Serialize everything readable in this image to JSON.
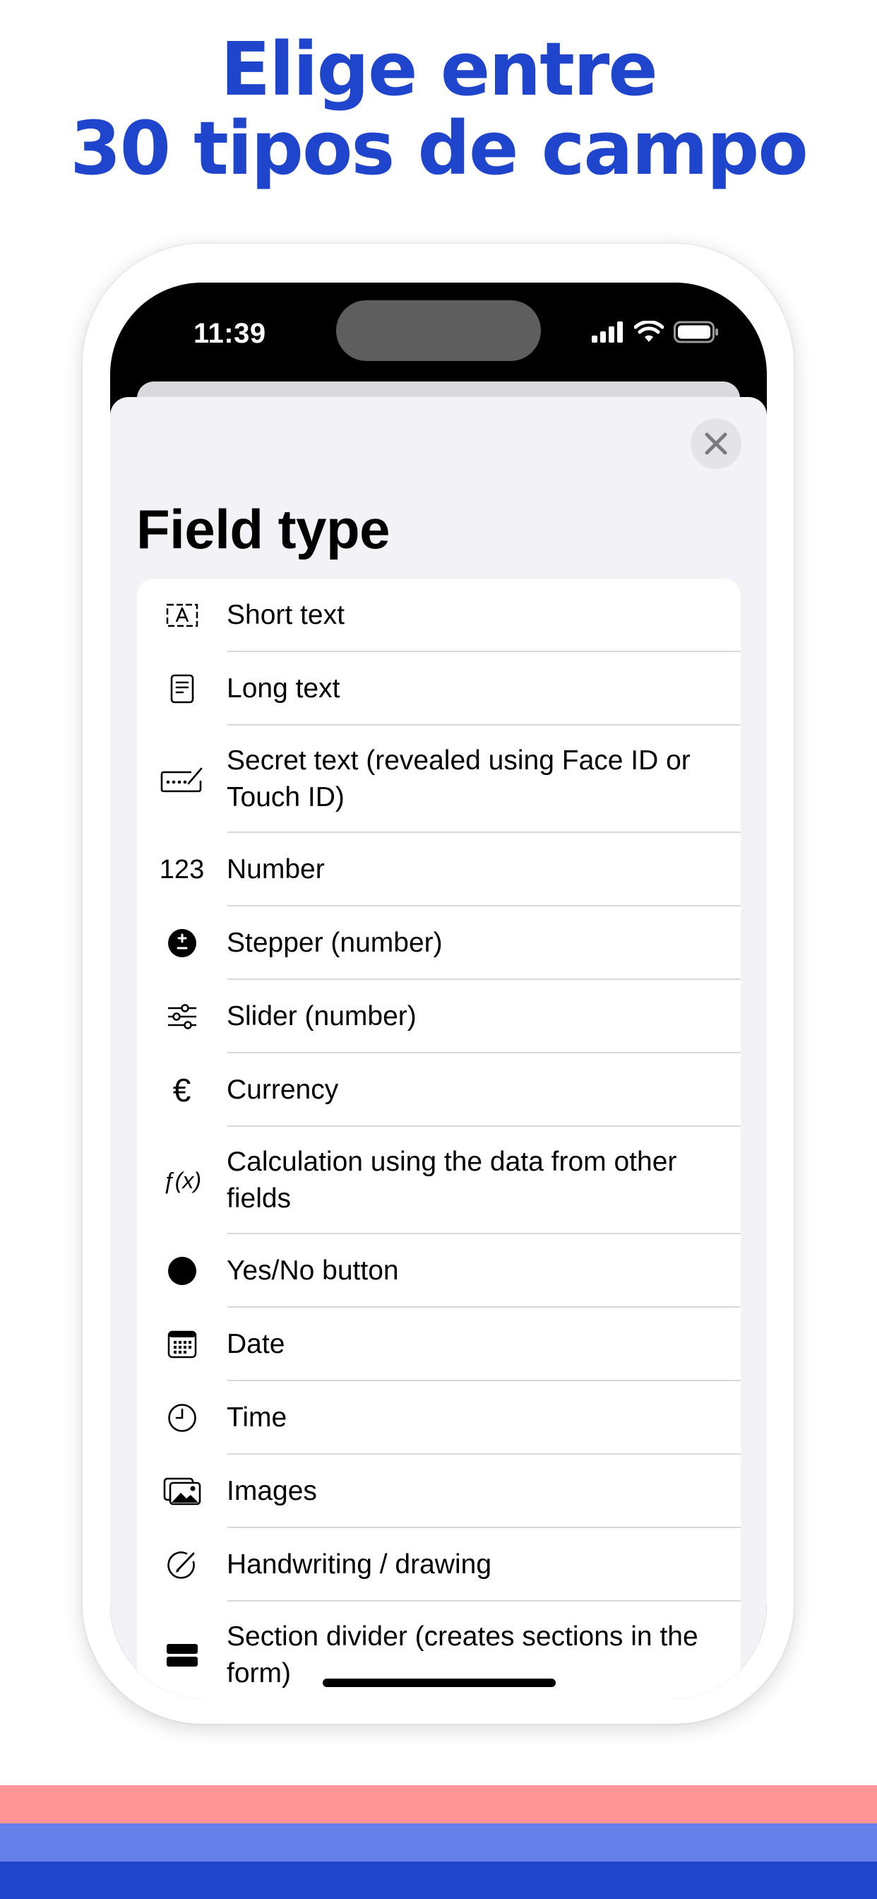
{
  "headline": {
    "line1": "Elige entre",
    "line2": "30 tipos de campo"
  },
  "status_bar": {
    "time": "11:39"
  },
  "sheet": {
    "title": "Field type"
  },
  "field_types": [
    {
      "label": "Short text",
      "icon": "short-text-icon"
    },
    {
      "label": "Long text",
      "icon": "long-text-icon"
    },
    {
      "label": "Secret text (revealed using Face ID or Touch ID)",
      "icon": "secret-text-icon"
    },
    {
      "label": "Number",
      "icon": "number-icon",
      "glyph": "123"
    },
    {
      "label": "Stepper (number)",
      "icon": "stepper-icon"
    },
    {
      "label": "Slider (number)",
      "icon": "slider-icon"
    },
    {
      "label": "Currency",
      "icon": "currency-icon",
      "glyph": "€"
    },
    {
      "label": "Calculation using the data from other fields",
      "icon": "calculation-icon",
      "glyph": "ƒ(x)"
    },
    {
      "label": "Yes/No button",
      "icon": "yes-no-icon"
    },
    {
      "label": "Date",
      "icon": "calendar-icon"
    },
    {
      "label": "Time",
      "icon": "clock-icon"
    },
    {
      "label": "Images",
      "icon": "images-icon"
    },
    {
      "label": "Handwriting / drawing",
      "icon": "drawing-icon"
    },
    {
      "label": "Section divider (creates sections in the form)",
      "icon": "section-divider-icon"
    }
  ],
  "colors": {
    "headline": "#1f45cc",
    "stripe_pink": "#ff9496",
    "stripe_mid_blue": "#6580e9",
    "stripe_dark_blue": "#1f45cc"
  }
}
